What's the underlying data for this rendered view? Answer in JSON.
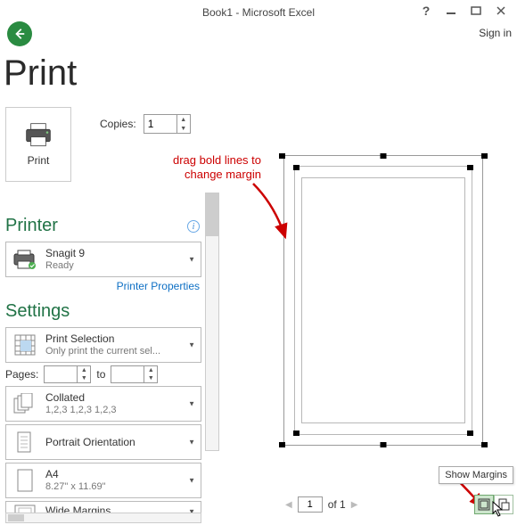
{
  "titlebar": {
    "title": "Book1 - Microsoft Excel",
    "help": "?",
    "signin": "Sign in"
  },
  "heading": "Print",
  "print_button": {
    "label": "Print"
  },
  "copies": {
    "label": "Copies:",
    "value": "1"
  },
  "printer": {
    "heading": "Printer",
    "name": "Snagit 9",
    "status": "Ready",
    "properties_link": "Printer Properties"
  },
  "settings": {
    "heading": "Settings",
    "selection": {
      "main": "Print Selection",
      "sub": "Only print the current sel..."
    },
    "pages": {
      "label": "Pages:",
      "to": "to",
      "from": "",
      "to_val": ""
    },
    "collated": {
      "main": "Collated",
      "sub": "1,2,3   1,2,3   1,2,3"
    },
    "orientation": {
      "main": "Portrait Orientation"
    },
    "paper": {
      "main": "A4",
      "sub": "8.27\" x 11.69\""
    },
    "margins": {
      "main": "Wide Margins"
    }
  },
  "pager": {
    "current": "1",
    "of_label": "of 1"
  },
  "tooltip": "Show Margins",
  "annotation": {
    "line1": "drag bold lines to",
    "line2": "change margin"
  }
}
